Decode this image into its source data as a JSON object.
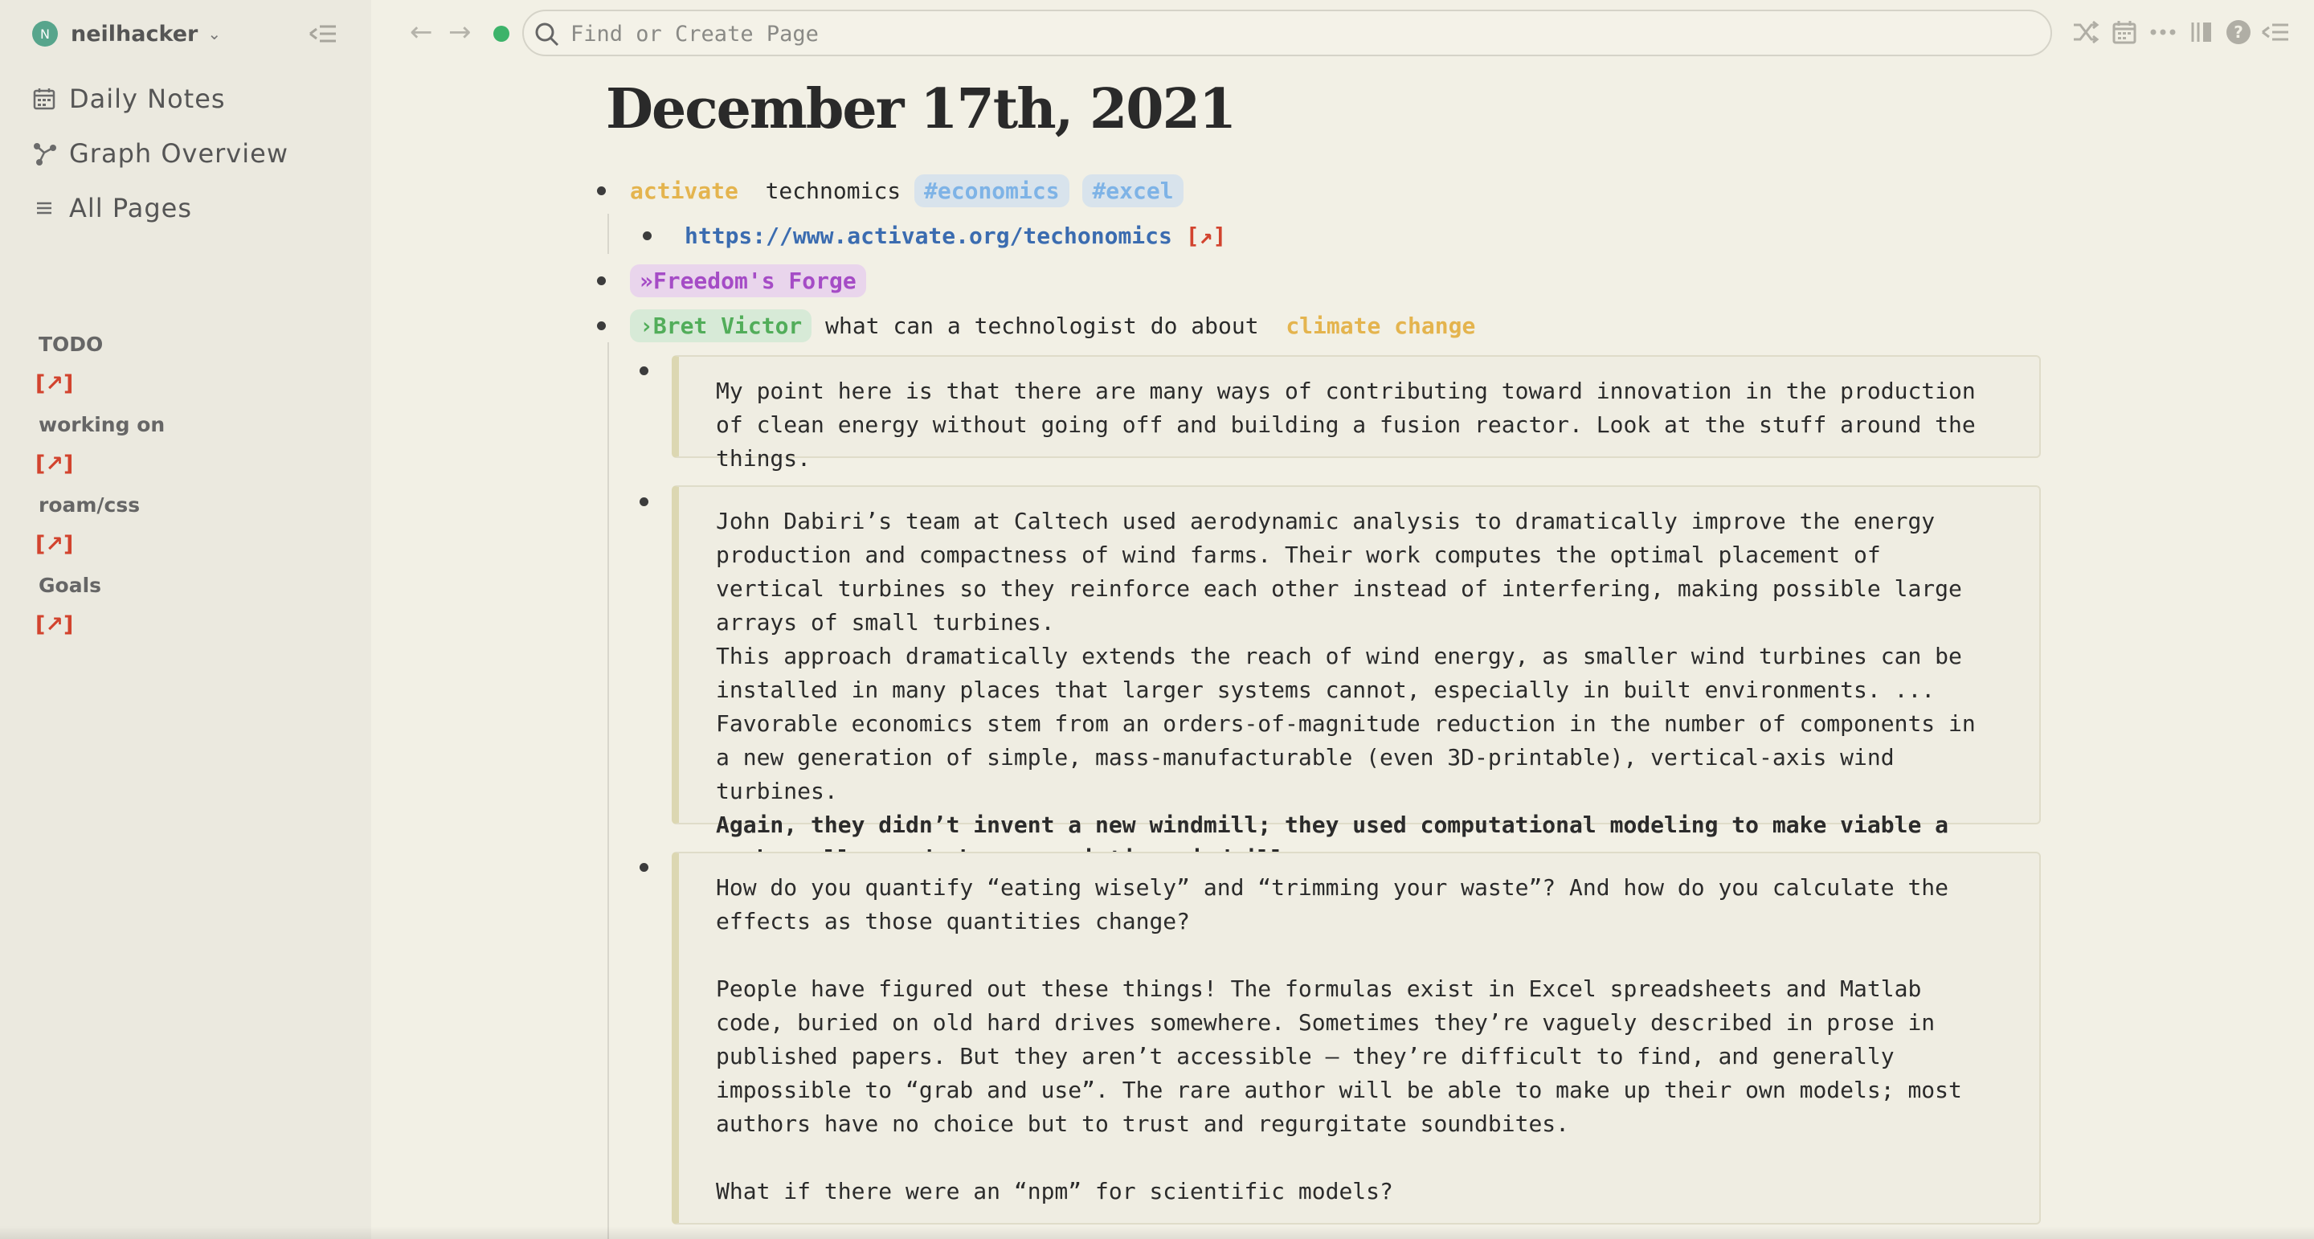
{
  "sidebar": {
    "graph_initial": "N",
    "graph_name": "neilhacker",
    "nav": [
      {
        "label": "Daily Notes"
      },
      {
        "label": "Graph Overview"
      },
      {
        "label": "All Pages"
      }
    ],
    "shortcuts": [
      {
        "label": "TODO",
        "link": "[↗]"
      },
      {
        "label": "working on",
        "link": "[↗]"
      },
      {
        "label": "roam/css",
        "link": "[↗]"
      },
      {
        "label": "Goals",
        "link": "[↗]"
      }
    ]
  },
  "topbar": {
    "back": "←",
    "forward": "→",
    "search_placeholder": "Find or Create Page"
  },
  "page": {
    "title": "December 17th, 2021",
    "blocks": {
      "b1": {
        "tag1": "activate",
        "word": "technomics",
        "tag2": "#economics",
        "tag3": "#excel"
      },
      "b1_child": {
        "url": "https://www.activate.org/techonomics",
        "ext": "[↗]"
      },
      "b2": {
        "ref": "»Freedom's Forge"
      },
      "b3": {
        "ref": "›Bret Victor",
        "text": "what can a technologist do about",
        "tag": "climate change"
      }
    },
    "quotes": {
      "q1": "My point here is that there are many ways of contributing toward innovation in the production of clean energy without going off and building a fusion reactor. Look at the stuff around the things.",
      "q2_p1": "John Dabiri’s team at Caltech used aerodynamic analysis to dramatically improve the energy production and compactness of wind farms. Their work computes the optimal placement of vertical turbines so they reinforce each other instead of interfering, making possible large arrays of small turbines.",
      "q2_p2": "This approach dramatically extends the reach of wind energy, as smaller wind turbines can be installed in many places that larger systems cannot, especially in built environments. ... Favorable economics stem from an orders-of-magnitude reduction in the number of components in a new generation of simple, mass-manufacturable (even 3D-printable), vertical-axis wind turbines.",
      "q2_bold": "Again, they didn’t invent a new windmill; they used computational modeling to make viable a much smaller and cheaper existing windmill",
      "q2_end": ".",
      "q3_p1": "How do you quantify “eating wisely” and “trimming your waste”? And how do you calculate the effects as those quantities change?",
      "q3_p2": "People have figured out these things! The formulas exist in Excel spreadsheets and Matlab code, buried on old hard drives somewhere. Sometimes they’re vaguely described in prose in published papers. But they aren’t accessible — they’re difficult to find, and generally impossible to “grab and use”. The rare author will be able to make up their own models; most authors have no choice but to trust and regurgitate soundbites.",
      "q3_p3": "What if there were an “npm” for scientific models?"
    }
  }
}
